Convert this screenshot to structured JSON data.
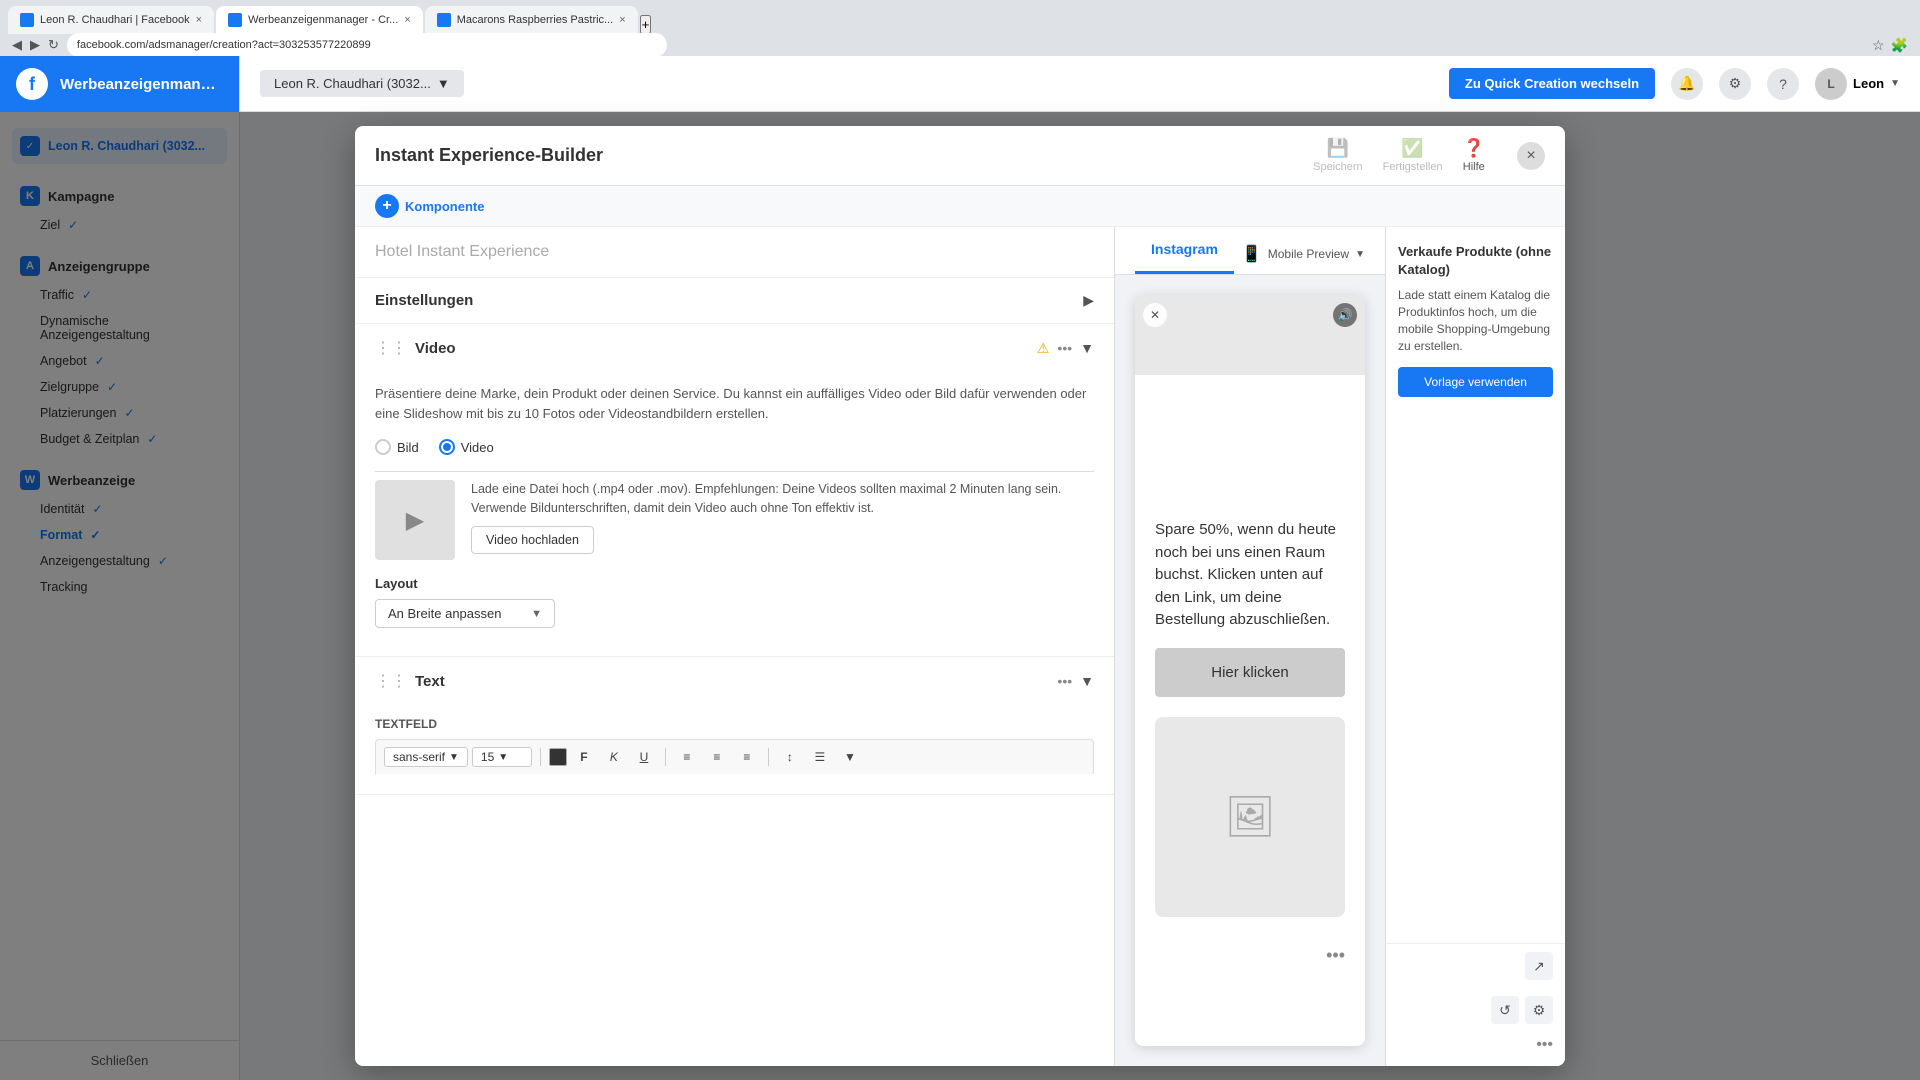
{
  "browser": {
    "tabs": [
      {
        "id": "tab1",
        "title": "Leon R. Chaudhari | Facebook",
        "favicon_color": "#1877f2",
        "active": false
      },
      {
        "id": "tab2",
        "title": "Werbeanzeigenmanager - Cr...",
        "favicon_color": "#1877f2",
        "active": true
      },
      {
        "id": "tab3",
        "title": "Macarons Raspberries Pastric...",
        "favicon_color": "#1877f2",
        "active": false
      }
    ],
    "address": "facebook.com/adsmanager/creation?act=303253577220899"
  },
  "fb_header": {
    "logo": "f",
    "title": "Werbeanzeigenmanager",
    "account": "Leon R. Chaudhari (3032...",
    "quick_creation_btn": "Zu Quick Creation wechseln",
    "user_name": "Leon"
  },
  "sidebar": {
    "account_label": "Leon R. Chaudhari (3032...",
    "sections": [
      {
        "name": "Kampagne",
        "icon": "K",
        "items": [
          {
            "label": "Ziel",
            "checked": true
          }
        ]
      },
      {
        "name": "Anzeigengruppe",
        "icon": "A",
        "items": [
          {
            "label": "Traffic",
            "checked": true
          },
          {
            "label": "Dynamische Anzeigengestaltung",
            "checked": false
          },
          {
            "label": "Angebot",
            "checked": true
          },
          {
            "label": "Zielgruppe",
            "checked": true
          },
          {
            "label": "Platzierungen",
            "checked": true
          },
          {
            "label": "Budget & Zeitplan",
            "checked": true
          }
        ]
      },
      {
        "name": "Werbeanzeige",
        "icon": "W",
        "items": [
          {
            "label": "Identität",
            "checked": true
          },
          {
            "label": "Format",
            "checked": true,
            "active": true
          },
          {
            "label": "Anzeigengestaltung",
            "checked": true
          },
          {
            "label": "Tracking",
            "checked": false
          }
        ]
      }
    ],
    "close_btn": "Schließen"
  },
  "modal": {
    "title": "Instant Experience-Builder",
    "close_icon": "×",
    "toolbar": {
      "component_label": "Komponente",
      "save_label": "Speichern",
      "finalize_label": "Fertigstellen",
      "help_label": "Hilfe"
    },
    "editor": {
      "name_placeholder": "Hotel Instant Experience",
      "settings_section": {
        "title": "Einstellungen",
        "expanded": false
      },
      "video_section": {
        "title": "Video",
        "description": "Präsentiere deine Marke, dein Produkt oder deinen Service. Du kannst ein auffälliges Video oder Bild dafür verwenden oder eine Slideshow mit bis zu 10 Fotos oder Videostandbildern erstellen.",
        "radio_bild": "Bild",
        "radio_video": "Video",
        "upload_hint": "Lade eine Datei hoch (.mp4 oder .mov). Empfehlungen: Deine Videos sollten maximal 2 Minuten lang sein. Verwende Bildunterschriften, damit dein Video auch ohne Ton effektiv ist.",
        "upload_btn": "Video hochladen",
        "layout_label": "Layout",
        "layout_option": "An Breite anpassen"
      },
      "text_section": {
        "title": "Text",
        "textfeld_label": "Textfeld",
        "font_family": "sans-serif",
        "font_size": "15",
        "toolbar_buttons": [
          "F",
          "K",
          "U"
        ]
      }
    },
    "preview": {
      "tabs": [
        "Instagram"
      ],
      "active_tab": "Instagram",
      "mobile_preview_label": "Mobile Preview",
      "ad_text": "Spare 50%, wenn du heute noch bei uns einen Raum buchst. Klicken unten auf den Link, um deine Bestellung abzuschließen.",
      "cta_label": "Hier klicken"
    }
  },
  "right_panel": {
    "title": "Verkaufe Produkte (ohne Katalog)",
    "description": "Lade statt einem Katalog die Produktinfos hoch, um die mobile Shopping-Umgebung zu erstellen.",
    "cta_btn": "Vorlage verwenden"
  }
}
